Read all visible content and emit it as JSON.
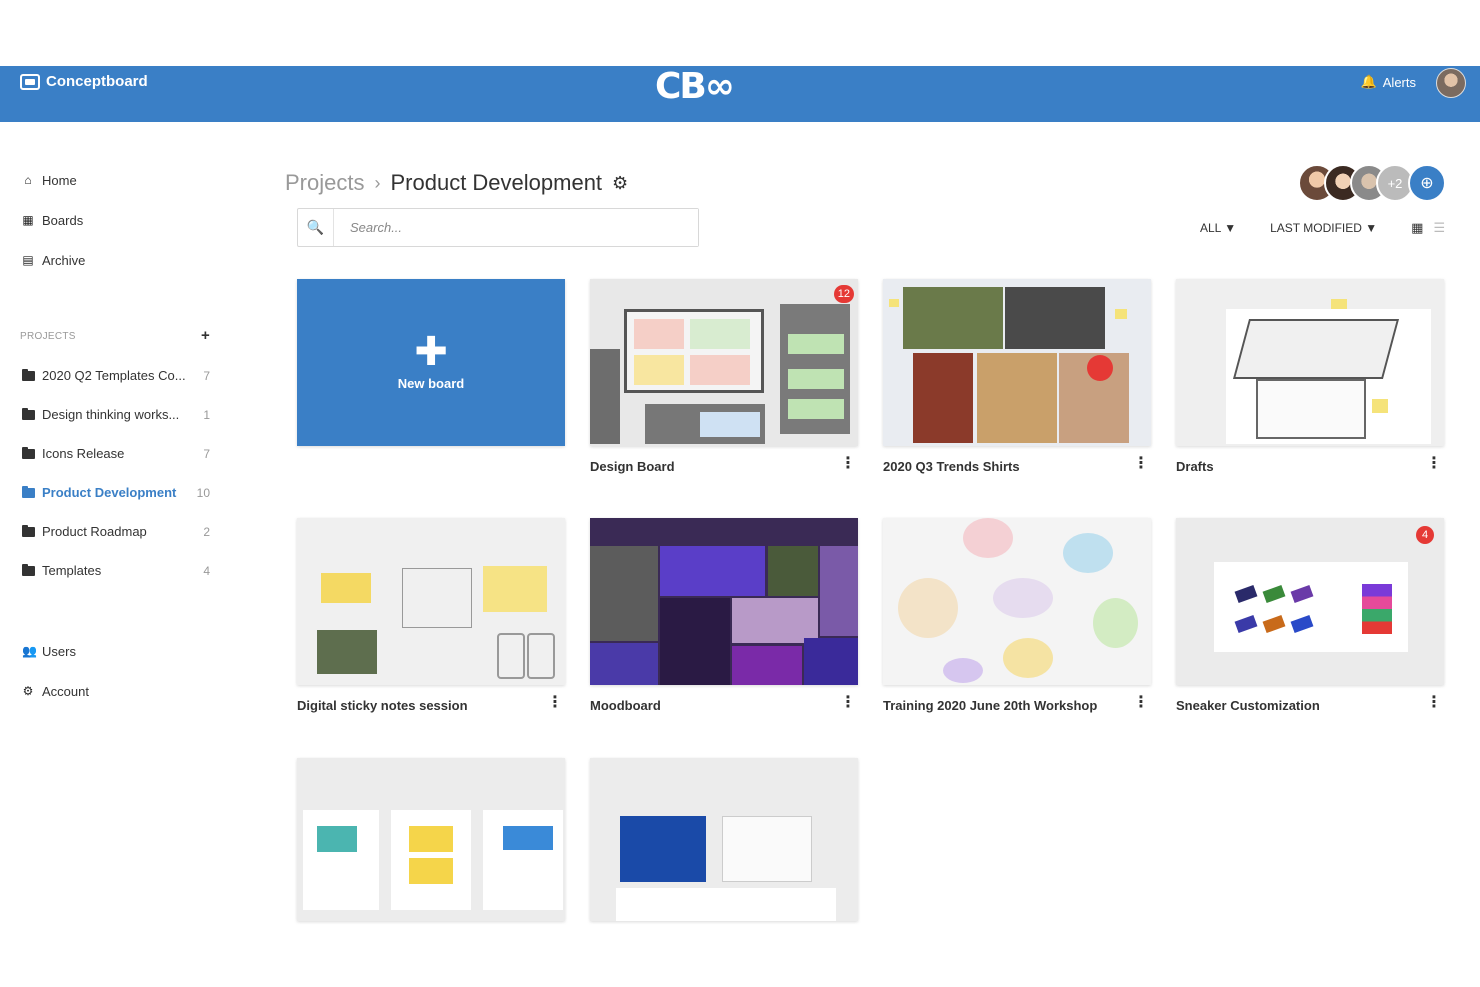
{
  "topbar": {
    "brand": "Conceptboard",
    "logo": "CB∞",
    "alerts": "Alerts"
  },
  "sidebar": {
    "nav": [
      {
        "label": "Home",
        "icon": "home-icon"
      },
      {
        "label": "Boards",
        "icon": "grid-icon"
      },
      {
        "label": "Archive",
        "icon": "archive-icon"
      }
    ],
    "projects_heading": "PROJECTS",
    "projects": [
      {
        "name": "2020 Q2 Templates Co...",
        "count": "7",
        "active": false
      },
      {
        "name": "Design thinking works...",
        "count": "1",
        "active": false
      },
      {
        "name": "Icons Release",
        "count": "7",
        "active": false
      },
      {
        "name": "Product Development",
        "count": "10",
        "active": true
      },
      {
        "name": "Product Roadmap",
        "count": "2",
        "active": false
      },
      {
        "name": "Templates",
        "count": "4",
        "active": false
      }
    ],
    "footer_nav": [
      {
        "label": "Users",
        "icon": "users-icon"
      },
      {
        "label": "Account",
        "icon": "gear-icon"
      }
    ]
  },
  "breadcrumb": {
    "root": "Projects",
    "current": "Product Development"
  },
  "team": {
    "more_count": "+2"
  },
  "search": {
    "placeholder": "Search..."
  },
  "filters": {
    "scope": "ALL ▼",
    "sort": "LAST MODIFIED ▼"
  },
  "new_board": {
    "label": "New board"
  },
  "boards": [
    {
      "title": "Design Board",
      "badge": "12"
    },
    {
      "title": "2020 Q3 Trends Shirts",
      "badge": ""
    },
    {
      "title": "Drafts",
      "badge": ""
    },
    {
      "title": "Digital sticky notes session",
      "badge": ""
    },
    {
      "title": "Moodboard",
      "badge": ""
    },
    {
      "title": "Training 2020 June 20th Workshop",
      "badge": ""
    },
    {
      "title": "Sneaker Customization",
      "badge": "4"
    },
    {
      "title": "",
      "badge": ""
    },
    {
      "title": "",
      "badge": ""
    }
  ],
  "colors": {
    "brand_blue": "#3a7fc6",
    "badge_red": "#e53935"
  }
}
